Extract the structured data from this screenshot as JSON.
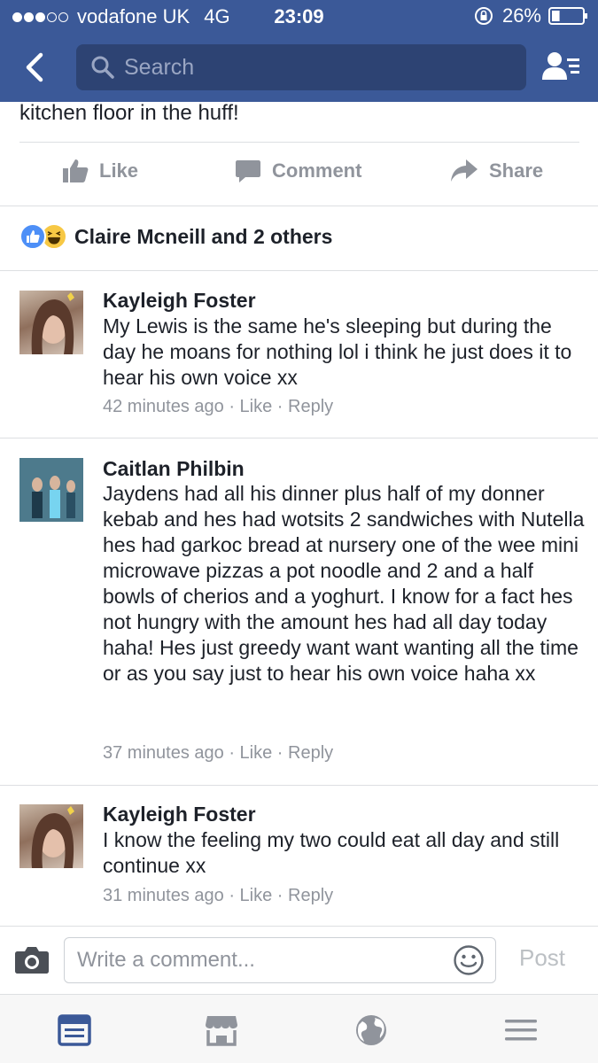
{
  "status_bar": {
    "carrier": "vodafone UK",
    "network": "4G",
    "time": "23:09",
    "battery": "26%",
    "signal_bars_filled": 3,
    "signal_bars_total": 5,
    "battery_level": 0.26
  },
  "search": {
    "placeholder": "Search"
  },
  "post": {
    "text_tail": "kitchen floor in the huff!"
  },
  "actions": {
    "like": "Like",
    "comment": "Comment",
    "share": "Share"
  },
  "reactions": {
    "summary": "Claire Mcneill and 2 others"
  },
  "comments": [
    {
      "author": "Kayleigh Foster",
      "text": "My Lewis is the same he's sleeping but during the day he moans for nothing lol i think he just does it to hear his own voice xx",
      "time": "42 minutes ago",
      "like": "Like",
      "reply": "Reply"
    },
    {
      "author": "Caitlan Philbin",
      "text": "Jaydens had all his dinner plus half of my donner kebab and hes had wotsits 2 sandwiches with Nutella hes had garkoc bread at nursery one of the wee mini microwave pizzas a pot noodle and 2 and a half bowls of cherios and a yoghurt. I know for a fact hes not hungry with the amount hes had all day today haha! Hes just greedy want want wanting all the time or as you say just to hear his own voice haha xx",
      "time": "37 minutes ago",
      "like": "Like",
      "reply": "Reply"
    },
    {
      "author": "Kayleigh Foster",
      "text": "I know the feeling my two could eat all day and still continue xx",
      "time": "31 minutes ago",
      "like": "Like",
      "reply": "Reply"
    }
  ],
  "composer": {
    "placeholder": "Write a comment...",
    "post_label": "Post"
  },
  "colors": {
    "brand": "#3b5998",
    "search_bg": "#2d4373",
    "meta": "#90949c",
    "like_blue": "#4d8ff7"
  },
  "icons": [
    "back-icon",
    "search-icon",
    "friend-requests-icon",
    "like-icon",
    "comment-icon",
    "share-icon",
    "like-reaction-icon",
    "haha-reaction-icon",
    "camera-icon",
    "emoji-icon",
    "news-feed-icon",
    "marketplace-icon",
    "notifications-globe-icon",
    "menu-icon"
  ]
}
